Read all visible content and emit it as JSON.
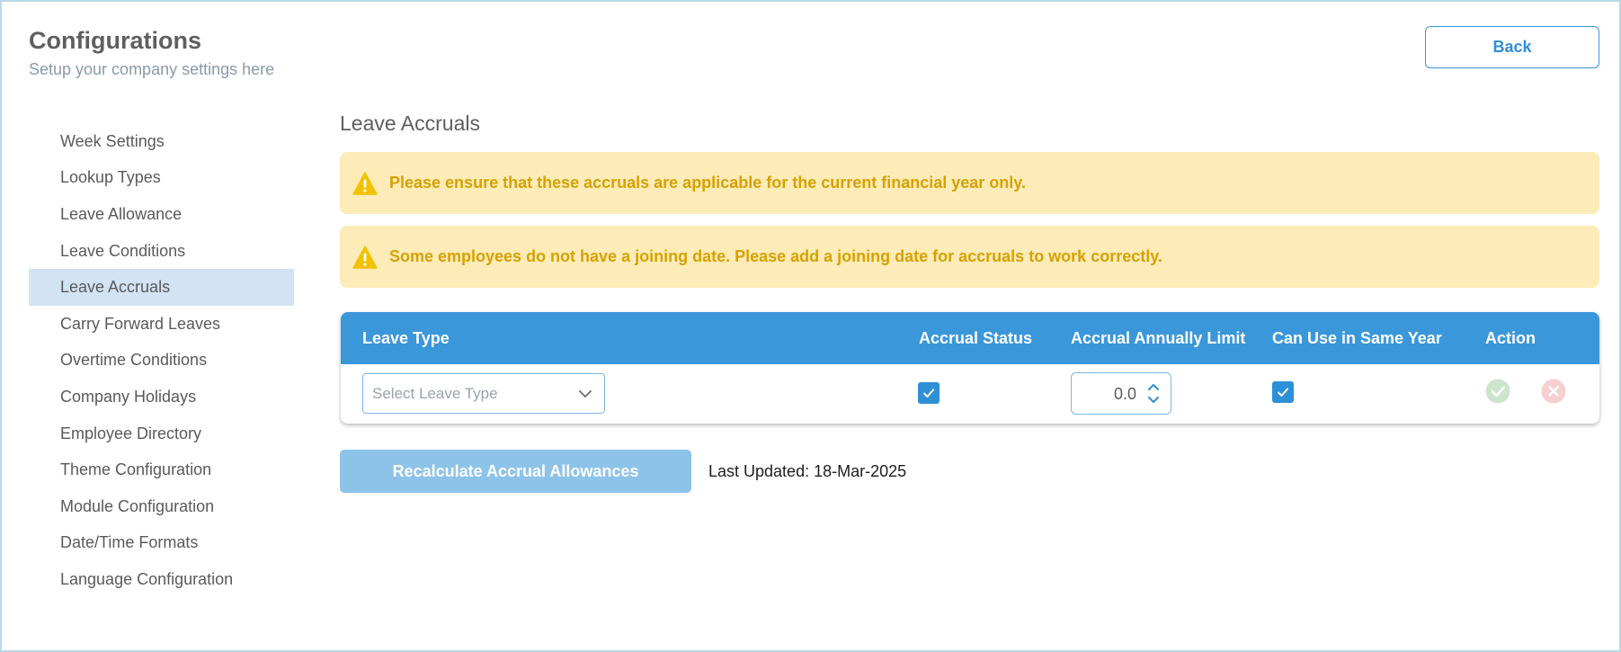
{
  "header": {
    "title": "Configurations",
    "subtitle": "Setup your company settings here",
    "back_label": "Back"
  },
  "sidebar": {
    "active_index": 4,
    "items": [
      {
        "label": "Week Settings"
      },
      {
        "label": "Lookup Types"
      },
      {
        "label": "Leave Allowance"
      },
      {
        "label": "Leave Conditions"
      },
      {
        "label": "Leave Accruals"
      },
      {
        "label": "Carry Forward Leaves"
      },
      {
        "label": "Overtime Conditions"
      },
      {
        "label": "Company Holidays"
      },
      {
        "label": "Employee Directory"
      },
      {
        "label": "Theme Configuration"
      },
      {
        "label": "Module Configuration"
      },
      {
        "label": "Date/Time Formats"
      },
      {
        "label": "Language Configuration"
      }
    ]
  },
  "main": {
    "section_title": "Leave Accruals",
    "alerts": [
      {
        "icon": "warning-icon",
        "text": "Please ensure that these accruals are applicable for the current financial year only."
      },
      {
        "icon": "warning-icon",
        "text": "Some employees do not have a joining date. Please add a joining date for accruals to work correctly."
      }
    ],
    "table": {
      "columns": [
        "Leave Type",
        "Accrual Status",
        "Accrual Annually Limit",
        "Can Use in Same Year",
        "Action"
      ],
      "row": {
        "leave_type_placeholder": "Select Leave Type",
        "accrual_status_checked": true,
        "annual_limit": "0.0",
        "same_year_checked": true,
        "actions": [
          "check-circle-icon",
          "close-circle-icon"
        ]
      }
    },
    "recalculate_label": "Recalculate Accrual Allowances",
    "last_updated": "Last Updated: 18-Mar-2025"
  },
  "colors": {
    "accent": "#3a97da",
    "alert_bg": "#fdecb8",
    "alert_text": "#d7a100",
    "active_nav_bg": "#d2e3f3",
    "recalc_button_bg": "#8ec3e9",
    "action_confirm": "#cde5cd",
    "action_cancel": "#f7cfd1"
  }
}
